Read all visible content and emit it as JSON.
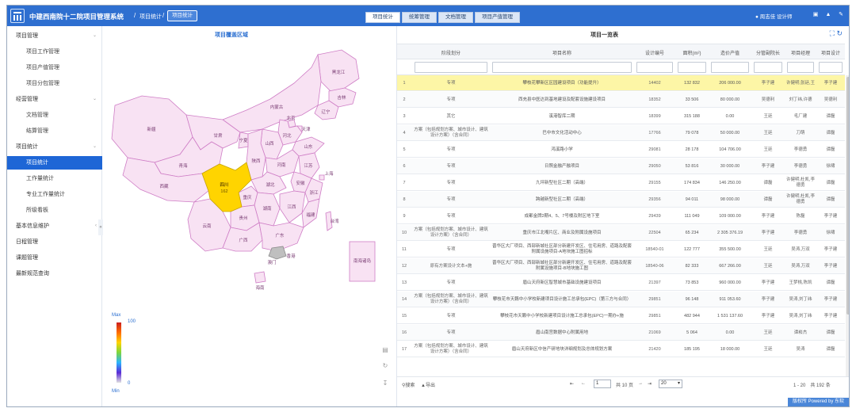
{
  "app": {
    "title": "中建西南院十二院项目管理系统",
    "breadcrumb": [
      "项目统计",
      "项目统计"
    ],
    "tabs": [
      {
        "label": "项目统计",
        "active": true
      },
      {
        "label": "统筹管理",
        "active": false
      },
      {
        "label": "文档管理",
        "active": false
      },
      {
        "label": "项目产值管理",
        "active": false
      }
    ],
    "user": "周志佳 设计师",
    "powered": "版权所 Powered by 东软"
  },
  "sidebar": {
    "items": [
      {
        "label": "项目管理",
        "level": 1,
        "arrow": "⌄"
      },
      {
        "label": "项目工作管理",
        "level": 2
      },
      {
        "label": "项目产值管理",
        "level": 2
      },
      {
        "label": "项目分包管理",
        "level": 2
      },
      {
        "label": "经营管理",
        "level": 1,
        "arrow": "⌄"
      },
      {
        "label": "文档管理",
        "level": 2
      },
      {
        "label": "结算管理",
        "level": 2
      },
      {
        "label": "项目统计",
        "level": 1,
        "arrow": "⌄"
      },
      {
        "label": "项目统计",
        "level": 2,
        "active": true
      },
      {
        "label": "工作量统计",
        "level": 2
      },
      {
        "label": "专业工作量统计",
        "level": 2
      },
      {
        "label": "所级看板",
        "level": 2
      },
      {
        "label": "基本信息维护",
        "level": 1,
        "arrow": "‹"
      },
      {
        "label": "日程管理",
        "level": 1
      },
      {
        "label": "课题管理",
        "level": 1
      },
      {
        "label": "最新规范查询",
        "level": 1
      }
    ]
  },
  "map": {
    "title": "项目覆盖区域",
    "legend": {
      "max": "Max",
      "min": "Min",
      "hi": "100",
      "lo": "0"
    },
    "highlighted": {
      "name": "四川",
      "value": "162"
    },
    "provinces": [
      "黑龙江",
      "吉林",
      "辽宁",
      "内蒙古",
      "北京",
      "天津",
      "河北",
      "新疆",
      "甘肃",
      "宁夏",
      "山西",
      "山东",
      "青海",
      "陕西",
      "河南",
      "江苏",
      "西藏",
      "湖北",
      "安徽",
      "上海",
      "浙江",
      "重庆",
      "湖南",
      "江西",
      "贵州",
      "福建",
      "台湾",
      "云南",
      "广西",
      "广东",
      "香港",
      "澳门",
      "海南",
      "南海诸岛"
    ]
  },
  "table": {
    "title": "项目一览表",
    "columns": [
      "",
      "阶段划分",
      "项目名称",
      "设计编号",
      "面积(m²)",
      "造价产值",
      "分管副院长",
      "项目经理",
      "项目设计"
    ],
    "rows": [
      [
        "1",
        "专项",
        "攀枝花攀新区区园建设项目（功能提升）",
        "14402",
        "132 832",
        "206 000.00",
        "李子建",
        "许健明,张廷,王",
        "李子建"
      ],
      [
        "2",
        "专项",
        "西充县中医达到基地建设及配套设施建设项目",
        "18352",
        "33 506",
        "80 000.00",
        "吴德利",
        "刘丁纬,许德",
        "吴德利"
      ],
      [
        "3",
        "其它",
        "溪港智库二期",
        "18399",
        "315 188",
        "0.00",
        "王廷",
        "毛厂建",
        "谭磊"
      ],
      [
        "4",
        "方案（包括规划方案、城市设计、建筑设计方案）（含合同）",
        "巴中市文化活动中心",
        "17766",
        "79 078",
        "50 000.00",
        "王廷",
        "刀萌",
        "谭磊"
      ],
      [
        "5",
        "专项",
        "鸿溪路小学",
        "29081",
        "28 178",
        "104 706.00",
        "王廷",
        "李德勇",
        "谭磊"
      ],
      [
        "6",
        "专项",
        "日照金融产融项目",
        "29050",
        "53 816",
        "30 000.00",
        "李子建",
        "李德勇",
        "徐啸"
      ],
      [
        "7",
        "专项",
        "九坪新型社区二期（高端）",
        "29155",
        "174 834",
        "146 250.00",
        "谭磊",
        "许健明,杜凯,李德勇",
        "谭磊"
      ],
      [
        "8",
        "专项",
        "跨越新型社区二期（高端）",
        "29356",
        "94 011",
        "98 000.00",
        "谭磊",
        "许健明,杜凯,李德勇",
        "谭磊"
      ],
      [
        "9",
        "专项",
        "成都金牌2期4、5、7号楼及附区地下室",
        "29439",
        "111 049",
        "109 000.00",
        "李子建",
        "陈磊",
        "李子建"
      ],
      [
        "10",
        "方案（包括规划方案、城市设计、建筑设计方案）（含合同）",
        "重庆市江北嘴片区、商业及附属设施项目",
        "22504",
        "65 234",
        "2 305 376.19",
        "李子建",
        "李德勇",
        "徐啸"
      ],
      [
        "11",
        "专项",
        "晋华区大厂项目、西部新城社区部分新建开发区、住宅用房、道路及配套附属设施项目-A地块施工图招标",
        "18540-01",
        "122 777",
        "355 500.00",
        "王廷",
        "吴涛,万双",
        "李子建"
      ],
      [
        "12",
        "原有方案设计文本+施",
        "晋华区大厂项目、西部新城社区部分新建开发区、住宅用房、道路及配套附属设施项目-B地块施工图",
        "18540-06",
        "82 333",
        "667 266.00",
        "王廷",
        "吴涛,万双",
        "李子建"
      ],
      [
        "13",
        "专项",
        "眉山天府新区智慧城市基础设施建设项目",
        "21397",
        "73 853",
        "960 000.00",
        "李子建",
        "王梦桃,陈凯",
        "谭磊"
      ],
      [
        "14",
        "方案（包括规划方案、城市设计、建筑设计方案）（含合同）",
        "攀枝花市天籁中小学校新建项目设计施工总承包(EPC)（第三方与合同）",
        "29851",
        "96 148",
        "911 053.60",
        "李子建",
        "吴涛,刘丁纬",
        "李子建"
      ],
      [
        "15",
        "专项",
        "攀枝花市天籁中小学校新建项目设计施工总承包(EPC)一期办+施",
        "29851",
        "482 944",
        "1 531 137.60",
        "李子建",
        "吴涛,刘丁纬",
        "李子建"
      ],
      [
        "16",
        "专项",
        "眉山南宫数据中心附属用地",
        "21069",
        "5 064",
        "0.00",
        "王廷",
        "谭崧杰",
        "谭磊"
      ],
      [
        "17",
        "方案（包括规划方案、城市设计、建筑设计方案）（含合同）",
        "眉山天府新区中信产研地块详细规划及总体规划方案",
        "21420",
        "185 195",
        "18 000.00",
        "王廷",
        "吴涛",
        "谭磊"
      ]
    ]
  },
  "pager": {
    "search": "搜索",
    "export": "导出",
    "first": "⇤",
    "prev": "←",
    "page": "1",
    "total_pages": "共 10 页",
    "next": "→",
    "last": "⇥",
    "per_page": "20",
    "range": "1 - 20　共 192 条"
  },
  "colors": {
    "topbar": "#2e6fd0",
    "highlight": "#fdf6a6",
    "sichuan": "#ffd400",
    "province_fill": "#f8e2f3",
    "province_stroke": "#cf7ec6"
  }
}
